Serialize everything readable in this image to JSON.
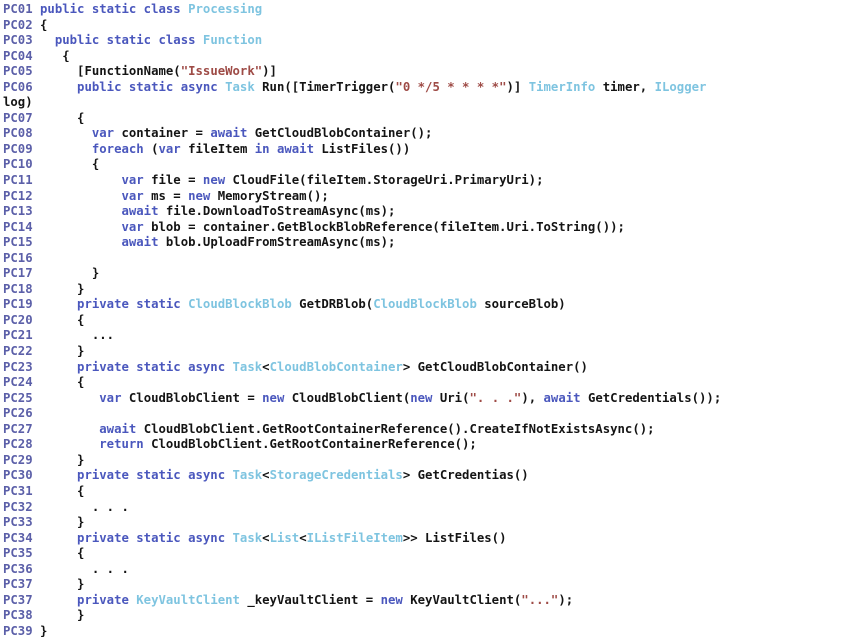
{
  "document": {
    "kind": "source-code-listing",
    "language": "C#",
    "background_color": "#ffffff"
  },
  "theme": {
    "line_number_color": "#5b5fa8",
    "plain_color": "#141414",
    "keyword_color": "#4a57bd",
    "type_color": "#7ec4e0",
    "string_color": "#9e4b46"
  },
  "lines": [
    {
      "number": "PC01",
      "tokens": [
        {
          "t": "plain",
          "s": " "
        },
        {
          "t": "kw",
          "s": "public static class"
        },
        {
          "t": "plain",
          "s": " "
        },
        {
          "t": "type",
          "s": "Processing"
        }
      ]
    },
    {
      "number": "PC02",
      "tokens": [
        {
          "t": "plain",
          "s": " {"
        }
      ]
    },
    {
      "number": "PC03",
      "tokens": [
        {
          "t": "plain",
          "s": "   "
        },
        {
          "t": "kw",
          "s": "public static class"
        },
        {
          "t": "plain",
          "s": " "
        },
        {
          "t": "type",
          "s": "Function"
        }
      ]
    },
    {
      "number": "PC04",
      "tokens": [
        {
          "t": "plain",
          "s": "    {"
        }
      ]
    },
    {
      "number": "PC05",
      "tokens": [
        {
          "t": "plain",
          "s": "      [FunctionName("
        },
        {
          "t": "str",
          "s": "\"IssueWork\""
        },
        {
          "t": "plain",
          "s": ")]"
        }
      ]
    },
    {
      "number": "PC06",
      "tokens": [
        {
          "t": "plain",
          "s": "      "
        },
        {
          "t": "kw",
          "s": "public static async"
        },
        {
          "t": "plain",
          "s": " "
        },
        {
          "t": "type",
          "s": "Task"
        },
        {
          "t": "plain",
          "s": " Run([TimerTrigger("
        },
        {
          "t": "str",
          "s": "\"0 */5 * * * *\""
        },
        {
          "t": "plain",
          "s": ")] "
        },
        {
          "t": "type",
          "s": "TimerInfo"
        },
        {
          "t": "plain",
          "s": " timer, "
        },
        {
          "t": "type",
          "s": "ILogger"
        }
      ]
    },
    {
      "number": "",
      "tokens": [
        {
          "t": "plain",
          "s": "log)"
        }
      ]
    },
    {
      "number": "PC07",
      "tokens": [
        {
          "t": "plain",
          "s": "      {"
        }
      ]
    },
    {
      "number": "PC08",
      "tokens": [
        {
          "t": "plain",
          "s": "        "
        },
        {
          "t": "kw",
          "s": "var"
        },
        {
          "t": "plain",
          "s": " container = "
        },
        {
          "t": "kw",
          "s": "await"
        },
        {
          "t": "plain",
          "s": " GetCloudBlobContainer();"
        }
      ]
    },
    {
      "number": "PC09",
      "tokens": [
        {
          "t": "plain",
          "s": "        "
        },
        {
          "t": "kw",
          "s": "foreach"
        },
        {
          "t": "plain",
          "s": " ("
        },
        {
          "t": "kw",
          "s": "var"
        },
        {
          "t": "plain",
          "s": " fileItem "
        },
        {
          "t": "kw",
          "s": "in await"
        },
        {
          "t": "plain",
          "s": " ListFiles())"
        }
      ]
    },
    {
      "number": "PC10",
      "tokens": [
        {
          "t": "plain",
          "s": "        {"
        }
      ]
    },
    {
      "number": "PC11",
      "tokens": [
        {
          "t": "plain",
          "s": "            "
        },
        {
          "t": "kw",
          "s": "var"
        },
        {
          "t": "plain",
          "s": " file = "
        },
        {
          "t": "kw",
          "s": "new"
        },
        {
          "t": "plain",
          "s": " CloudFile(fileItem.StorageUri.PrimaryUri);"
        }
      ]
    },
    {
      "number": "PC12",
      "tokens": [
        {
          "t": "plain",
          "s": "            "
        },
        {
          "t": "kw",
          "s": "var"
        },
        {
          "t": "plain",
          "s": " ms = "
        },
        {
          "t": "kw",
          "s": "new"
        },
        {
          "t": "plain",
          "s": " MemoryStream();"
        }
      ]
    },
    {
      "number": "PC13",
      "tokens": [
        {
          "t": "plain",
          "s": "            "
        },
        {
          "t": "kw",
          "s": "await"
        },
        {
          "t": "plain",
          "s": " file.DownloadToStreamAsync(ms);"
        }
      ]
    },
    {
      "number": "PC14",
      "tokens": [
        {
          "t": "plain",
          "s": "            "
        },
        {
          "t": "kw",
          "s": "var"
        },
        {
          "t": "plain",
          "s": " blob = container.GetBlockBlobReference(fileItem.Uri.ToString());"
        }
      ]
    },
    {
      "number": "PC15",
      "tokens": [
        {
          "t": "plain",
          "s": "            "
        },
        {
          "t": "kw",
          "s": "await"
        },
        {
          "t": "plain",
          "s": " blob.UploadFromStreamAsync(ms);"
        }
      ]
    },
    {
      "number": "PC16",
      "tokens": []
    },
    {
      "number": "PC17",
      "tokens": [
        {
          "t": "plain",
          "s": "        }"
        }
      ]
    },
    {
      "number": "PC18",
      "tokens": [
        {
          "t": "plain",
          "s": "      }"
        }
      ]
    },
    {
      "number": "PC19",
      "tokens": [
        {
          "t": "plain",
          "s": "      "
        },
        {
          "t": "kw",
          "s": "private static"
        },
        {
          "t": "plain",
          "s": " "
        },
        {
          "t": "type",
          "s": "CloudBlockBlob"
        },
        {
          "t": "plain",
          "s": " GetDRBlob("
        },
        {
          "t": "type",
          "s": "CloudBlockBlob"
        },
        {
          "t": "plain",
          "s": " sourceBlob)"
        }
      ]
    },
    {
      "number": "PC20",
      "tokens": [
        {
          "t": "plain",
          "s": "      {"
        }
      ]
    },
    {
      "number": "PC21",
      "tokens": [
        {
          "t": "plain",
          "s": "        ..."
        }
      ]
    },
    {
      "number": "PC22",
      "tokens": [
        {
          "t": "plain",
          "s": "      }"
        }
      ]
    },
    {
      "number": "PC23",
      "tokens": [
        {
          "t": "plain",
          "s": "      "
        },
        {
          "t": "kw",
          "s": "private static async"
        },
        {
          "t": "plain",
          "s": " "
        },
        {
          "t": "type",
          "s": "Task"
        },
        {
          "t": "plain",
          "s": "<"
        },
        {
          "t": "type",
          "s": "CloudBlobContainer"
        },
        {
          "t": "plain",
          "s": "> GetCloudBlobContainer()"
        }
      ]
    },
    {
      "number": "PC24",
      "tokens": [
        {
          "t": "plain",
          "s": "      {"
        }
      ]
    },
    {
      "number": "PC25",
      "tokens": [
        {
          "t": "plain",
          "s": "         "
        },
        {
          "t": "kw",
          "s": "var"
        },
        {
          "t": "plain",
          "s": " CloudBlobClient = "
        },
        {
          "t": "kw",
          "s": "new"
        },
        {
          "t": "plain",
          "s": " CloudBlobClient("
        },
        {
          "t": "kw",
          "s": "new"
        },
        {
          "t": "plain",
          "s": " Uri("
        },
        {
          "t": "str",
          "s": "\". . .\""
        },
        {
          "t": "plain",
          "s": "), "
        },
        {
          "t": "kw",
          "s": "await"
        },
        {
          "t": "plain",
          "s": " GetCredentials());"
        }
      ]
    },
    {
      "number": "PC26",
      "tokens": []
    },
    {
      "number": "PC27",
      "tokens": [
        {
          "t": "plain",
          "s": "         "
        },
        {
          "t": "kw",
          "s": "await"
        },
        {
          "t": "plain",
          "s": " CloudBlobClient.GetRootContainerReference().CreateIfNotExistsAsync();"
        }
      ]
    },
    {
      "number": "PC28",
      "tokens": [
        {
          "t": "plain",
          "s": "         "
        },
        {
          "t": "kw",
          "s": "return"
        },
        {
          "t": "plain",
          "s": " CloudBlobClient.GetRootContainerReference();"
        }
      ]
    },
    {
      "number": "PC29",
      "tokens": [
        {
          "t": "plain",
          "s": "      }"
        }
      ]
    },
    {
      "number": "PC30",
      "tokens": [
        {
          "t": "plain",
          "s": "      "
        },
        {
          "t": "kw",
          "s": "private static async"
        },
        {
          "t": "plain",
          "s": " "
        },
        {
          "t": "type",
          "s": "Task"
        },
        {
          "t": "plain",
          "s": "<"
        },
        {
          "t": "type",
          "s": "StorageCredentials"
        },
        {
          "t": "plain",
          "s": "> GetCredentias()"
        }
      ]
    },
    {
      "number": "PC31",
      "tokens": [
        {
          "t": "plain",
          "s": "      {"
        }
      ]
    },
    {
      "number": "PC32",
      "tokens": [
        {
          "t": "plain",
          "s": "        . . ."
        }
      ]
    },
    {
      "number": "PC33",
      "tokens": [
        {
          "t": "plain",
          "s": "      }"
        }
      ]
    },
    {
      "number": "PC34",
      "tokens": [
        {
          "t": "plain",
          "s": "      "
        },
        {
          "t": "kw",
          "s": "private static async"
        },
        {
          "t": "plain",
          "s": " "
        },
        {
          "t": "type",
          "s": "Task"
        },
        {
          "t": "plain",
          "s": "<"
        },
        {
          "t": "type",
          "s": "List"
        },
        {
          "t": "plain",
          "s": "<"
        },
        {
          "t": "type",
          "s": "IListFileItem"
        },
        {
          "t": "plain",
          "s": ">> ListFiles()"
        }
      ]
    },
    {
      "number": "PC35",
      "tokens": [
        {
          "t": "plain",
          "s": "      {"
        }
      ]
    },
    {
      "number": "PC36",
      "tokens": [
        {
          "t": "plain",
          "s": "        . . ."
        }
      ]
    },
    {
      "number": "PC37",
      "tokens": [
        {
          "t": "plain",
          "s": "      }"
        }
      ]
    },
    {
      "number": "PC37",
      "tokens": [
        {
          "t": "plain",
          "s": "      "
        },
        {
          "t": "kw",
          "s": "private"
        },
        {
          "t": "plain",
          "s": " "
        },
        {
          "t": "type",
          "s": "KeyVaultClient"
        },
        {
          "t": "plain",
          "s": " _keyVaultClient = "
        },
        {
          "t": "kw",
          "s": "new"
        },
        {
          "t": "plain",
          "s": " KeyVaultClient("
        },
        {
          "t": "str",
          "s": "\"...\""
        },
        {
          "t": "plain",
          "s": ");"
        }
      ]
    },
    {
      "number": "PC38",
      "tokens": [
        {
          "t": "plain",
          "s": "      }"
        }
      ]
    },
    {
      "number": "PC39",
      "tokens": [
        {
          "t": "plain",
          "s": " }"
        }
      ]
    }
  ]
}
